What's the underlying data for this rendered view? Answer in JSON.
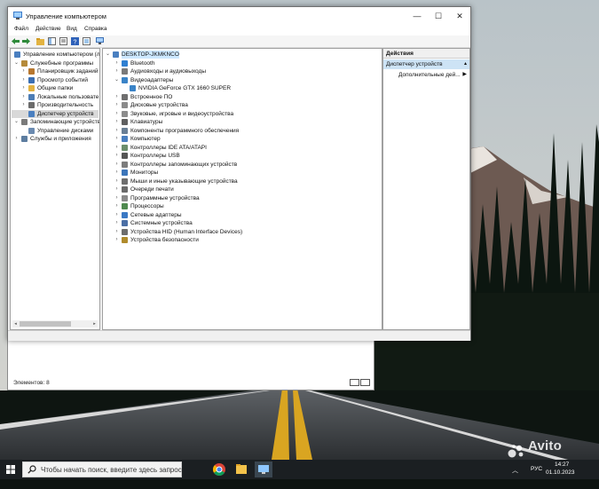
{
  "window": {
    "title": "Управление компьютером",
    "controls": {
      "minimize": "—",
      "maximize": "☐",
      "close": "✕"
    }
  },
  "menu": [
    "Файл",
    "Действие",
    "Вид",
    "Справка"
  ],
  "toolbar_icons": [
    "back-arrow-icon",
    "forward-arrow-icon",
    "folder-up-icon",
    "show-hide-tree-icon",
    "properties-icon",
    "help-icon",
    "extra-view-icon",
    "monitor-icon"
  ],
  "left_tree": [
    {
      "label": "Управление компьютером (л",
      "level": 0,
      "chevron": "",
      "icon": "computer-management-icon"
    },
    {
      "label": "Служебные программы",
      "level": 1,
      "chevron": "v",
      "icon": "tools-icon"
    },
    {
      "label": "Планировщик заданий",
      "level": 2,
      "chevron": ">",
      "icon": "task-scheduler-icon"
    },
    {
      "label": "Просмотр событий",
      "level": 2,
      "chevron": ">",
      "icon": "event-viewer-icon"
    },
    {
      "label": "Общие папки",
      "level": 2,
      "chevron": ">",
      "icon": "shared-folder-icon"
    },
    {
      "label": "Локальные пользовате",
      "level": 2,
      "chevron": ">",
      "icon": "users-icon"
    },
    {
      "label": "Производительность",
      "level": 2,
      "chevron": ">",
      "icon": "performance-icon"
    },
    {
      "label": "Диспетчер устройств",
      "level": 2,
      "chevron": "",
      "icon": "device-manager-icon",
      "selected": true
    },
    {
      "label": "Запоминающие устройств",
      "level": 1,
      "chevron": "v",
      "icon": "storage-icon"
    },
    {
      "label": "Управление дисками",
      "level": 2,
      "chevron": "",
      "icon": "disk-management-icon"
    },
    {
      "label": "Службы и приложения",
      "level": 1,
      "chevron": ">",
      "icon": "services-icon"
    }
  ],
  "device_tree": {
    "root": "DESKTOP-JKMKNCO",
    "items": [
      {
        "label": "Bluetooth",
        "chevron": ">",
        "icon": "bluetooth-icon",
        "level": 1
      },
      {
        "label": "Аудиовходы и аудиовыходы",
        "chevron": ">",
        "icon": "audio-io-icon",
        "level": 1
      },
      {
        "label": "Видеоадаптеры",
        "chevron": "v",
        "icon": "display-adapter-icon",
        "level": 1
      },
      {
        "label": "NVIDIA GeForce GTX 1660 SUPER",
        "chevron": "",
        "icon": "display-adapter-icon",
        "level": 2
      },
      {
        "label": "Встроенное ПО",
        "chevron": ">",
        "icon": "firmware-icon",
        "level": 1
      },
      {
        "label": "Дисковые устройства",
        "chevron": ">",
        "icon": "disk-drive-icon",
        "level": 1
      },
      {
        "label": "Звуковые, игровые и видеоустройства",
        "chevron": ">",
        "icon": "sound-icon",
        "level": 1
      },
      {
        "label": "Клавиатуры",
        "chevron": ">",
        "icon": "keyboard-icon",
        "level": 1
      },
      {
        "label": "Компоненты программного обеспечения",
        "chevron": ">",
        "icon": "software-component-icon",
        "level": 1
      },
      {
        "label": "Компьютер",
        "chevron": ">",
        "icon": "computer-icon",
        "level": 1
      },
      {
        "label": "Контроллеры IDE ATA/ATAPI",
        "chevron": ">",
        "icon": "ide-controller-icon",
        "level": 1
      },
      {
        "label": "Контроллеры USB",
        "chevron": ">",
        "icon": "usb-icon",
        "level": 1
      },
      {
        "label": "Контроллеры запоминающих устройств",
        "chevron": ">",
        "icon": "storage-controller-icon",
        "level": 1
      },
      {
        "label": "Мониторы",
        "chevron": ">",
        "icon": "monitor-icon",
        "level": 1
      },
      {
        "label": "Мыши и иные указывающие устройства",
        "chevron": ">",
        "icon": "mouse-icon",
        "level": 1
      },
      {
        "label": "Очереди печати",
        "chevron": ">",
        "icon": "print-queue-icon",
        "level": 1
      },
      {
        "label": "Программные устройства",
        "chevron": ">",
        "icon": "software-device-icon",
        "level": 1
      },
      {
        "label": "Процессоры",
        "chevron": ">",
        "icon": "processor-icon",
        "level": 1
      },
      {
        "label": "Сетевые адаптеры",
        "chevron": ">",
        "icon": "network-adapter-icon",
        "level": 1
      },
      {
        "label": "Системные устройства",
        "chevron": ">",
        "icon": "system-device-icon",
        "level": 1
      },
      {
        "label": "Устройства HID (Human Interface Devices)",
        "chevron": ">",
        "icon": "hid-icon",
        "level": 1
      },
      {
        "label": "Устройства безопасности",
        "chevron": ">",
        "icon": "security-device-icon",
        "level": 1
      }
    ]
  },
  "actions": {
    "header": "Действия",
    "section": "Диспетчер устройств",
    "more": "Дополнительные дей..."
  },
  "background_window": {
    "status": "Элементов: 8"
  },
  "taskbar": {
    "search_placeholder": "Чтобы начать поиск, введите здесь запрос",
    "apps": [
      "chrome-icon",
      "file-explorer-icon",
      "folder-icon",
      "computer-management-icon"
    ],
    "language": "РУС",
    "time": "14:27",
    "date": "01.10.2023"
  },
  "watermark": "Avito",
  "colors": {
    "selection": "#cce8ff",
    "accent": "#0078d7",
    "taskbar": "#1b1f22"
  }
}
